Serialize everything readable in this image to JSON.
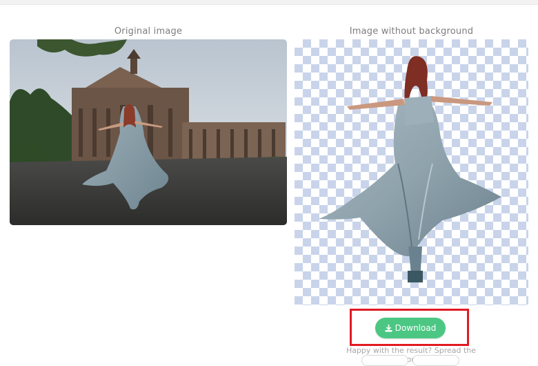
{
  "labels": {
    "original": "Original image",
    "result": "Image without background"
  },
  "download": {
    "label": "Download",
    "icon": "download-icon",
    "color": "#4cc783",
    "highlight_color": "#e01a22"
  },
  "share": {
    "text": "Happy with the result? Spread the word:"
  },
  "images": {
    "original": "photo of woman in flowing grey-blue dress in front of historic building",
    "result": "woman in flowing dress cut out on transparent background"
  }
}
